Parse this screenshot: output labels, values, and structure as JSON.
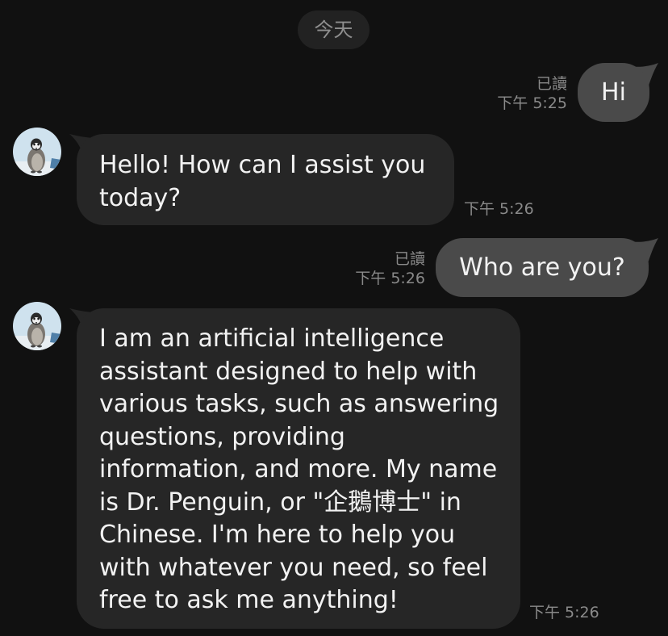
{
  "chat": {
    "date_label": "今天",
    "messages": [
      {
        "sender": "me",
        "text": "Hi",
        "read": "已讀",
        "time": "下午 5:25"
      },
      {
        "sender": "bot",
        "text": "Hello! How can I assist you today?",
        "time": "下午 5:26"
      },
      {
        "sender": "me",
        "text": "Who are you?",
        "read": "已讀",
        "time": "下午 5:26"
      },
      {
        "sender": "bot",
        "text": "I am an artificial intelligence assistant designed to help with various tasks, such as answering questions, providing information, and more. My name is Dr. Penguin, or \"企鵝博士\" in Chinese. I'm here to help you with whatever you need, so feel free to ask me anything!",
        "time": "下午 5:26"
      }
    ]
  },
  "icons": {
    "bot_avatar": "penguin-avatar-icon"
  },
  "colors": {
    "background": "#111111",
    "incoming_bubble": "#262626",
    "outgoing_bubble": "#4a4a4a",
    "meta_text": "#8a8a8a"
  }
}
